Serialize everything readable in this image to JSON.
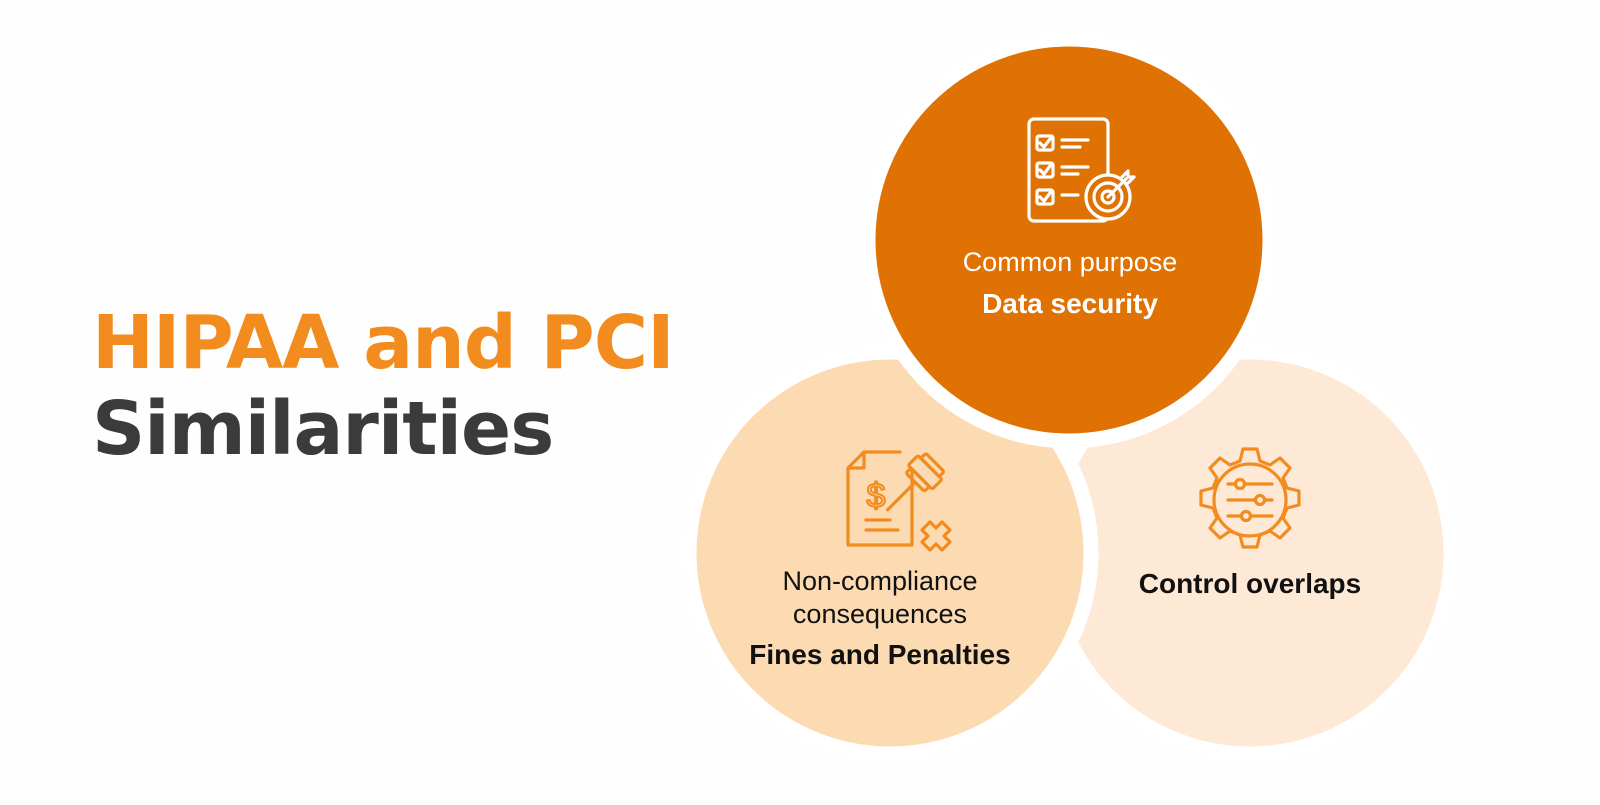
{
  "title": {
    "line1": "HIPAA and PCI",
    "line2": "Similarities"
  },
  "circles": [
    {
      "id": "top",
      "subtitle": "Common purpose",
      "label": "Data security",
      "icon": "checklist-target-icon",
      "fill": "#df7203"
    },
    {
      "id": "left",
      "subtitle": "Non-compliance consequences",
      "label": "Fines and Penalties",
      "icon": "gavel-dollar-document-icon",
      "fill": "#fcdbb3"
    },
    {
      "id": "right",
      "subtitle": "",
      "label": "Control overlaps",
      "icon": "gear-sliders-icon",
      "fill": "#fde9d5"
    }
  ],
  "colors": {
    "title_accent": "#f28c1e",
    "title_dark": "#3b3b3c",
    "icon_on_dark": "#ffffff",
    "icon_on_light": "#f28c1e"
  }
}
